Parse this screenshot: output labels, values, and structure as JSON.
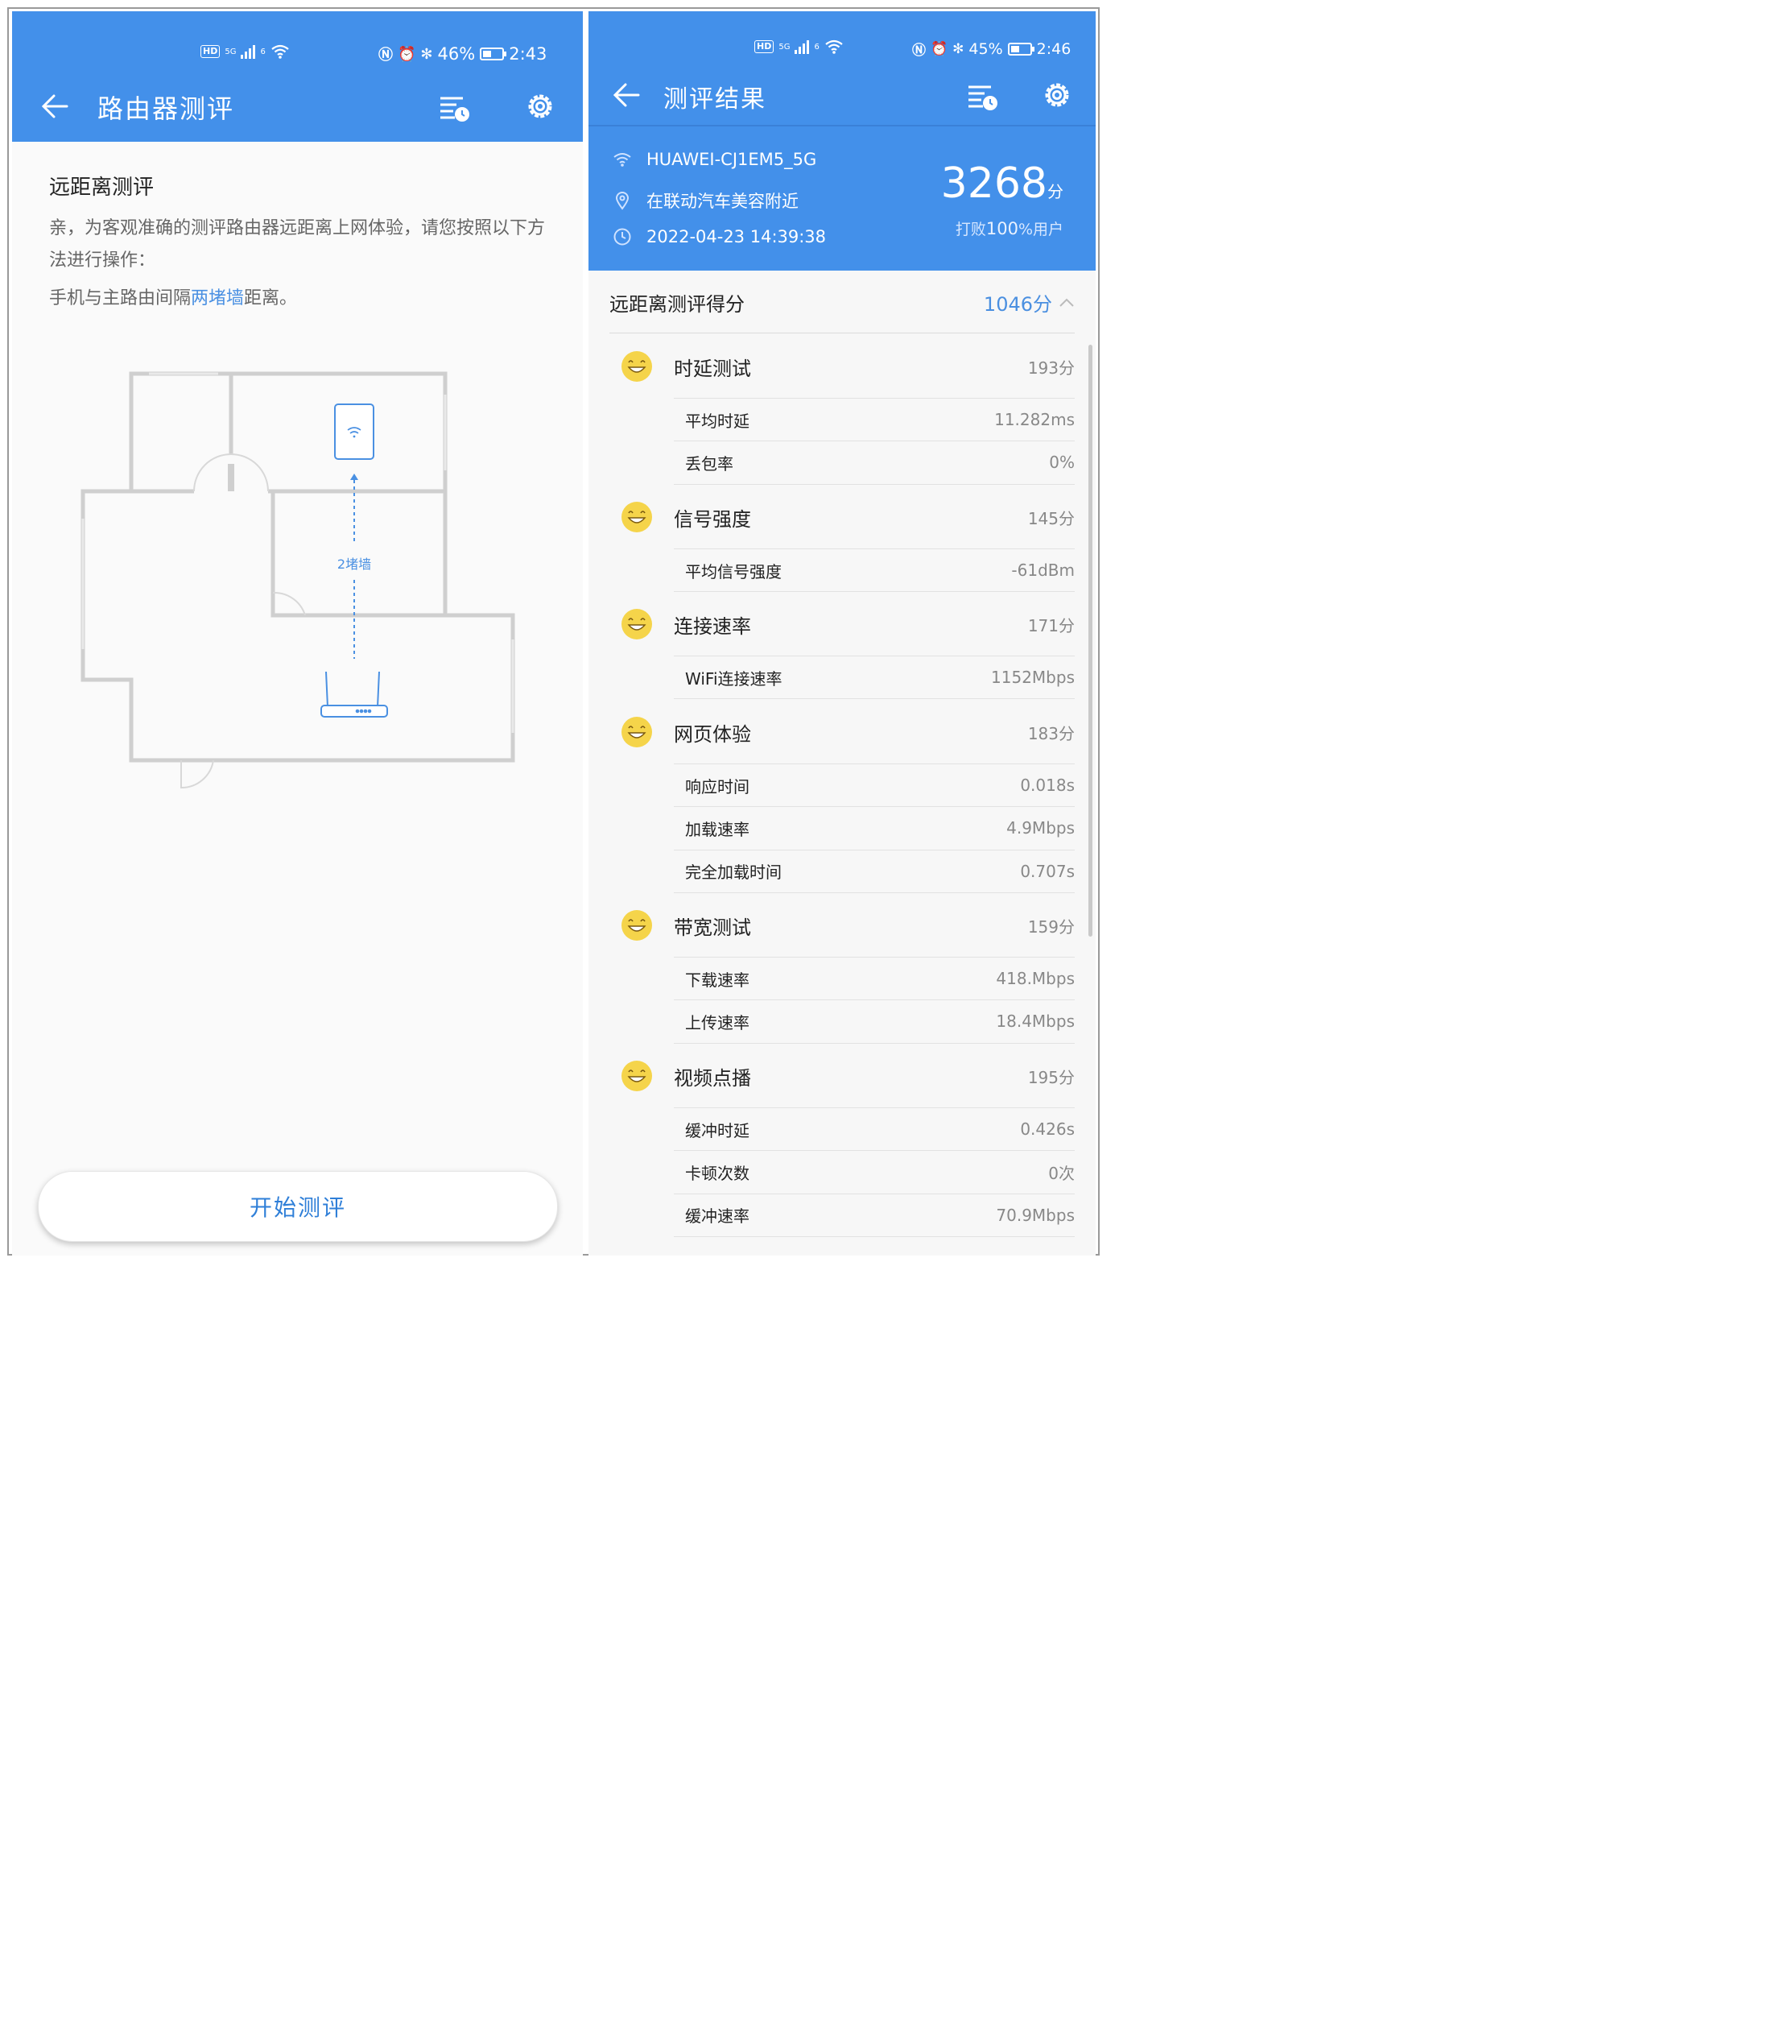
{
  "left": {
    "status": {
      "hd": "HD",
      "net": "5G",
      "wifi_sup": "6",
      "battery": "46%",
      "battery_level": 0.46,
      "time": "2:43"
    },
    "appbar": {
      "title": "路由器测评"
    },
    "section_title": "远距离测评",
    "instruction": "亲，为客观准确的测评路由器远距离上网体验，请您按照以下方法进行操作：",
    "distance_prefix": "手机与主路由间隔",
    "distance_highlight": "两堵墙",
    "distance_suffix": "距离。",
    "plan_wall_label": "2堵墙",
    "start_button": "开始测评"
  },
  "right": {
    "status": {
      "hd": "HD",
      "net": "5G",
      "wifi_sup": "6",
      "battery": "45%",
      "battery_level": 0.45,
      "time": "2:46"
    },
    "appbar": {
      "title": "测评结果"
    },
    "info": {
      "ssid": "HUAWEI-CJ1EM5_5G",
      "location": "在联动汽车美容附近",
      "datetime": "2022-04-23 14:39:38"
    },
    "total_score": "3268",
    "score_unit": "分",
    "beat_prefix": "打败",
    "beat_percent": "100",
    "beat_suffix": "%用户",
    "section": {
      "label": "远距离测评得分",
      "score": "1046分"
    },
    "categories": [
      {
        "name": "时延测试",
        "score": "193分"
      },
      {
        "name": "信号强度",
        "score": "145分"
      },
      {
        "name": "连接速率",
        "score": "171分"
      },
      {
        "name": "网页体验",
        "score": "183分"
      },
      {
        "name": "带宽测试",
        "score": "159分"
      },
      {
        "name": "视频点播",
        "score": "195分"
      }
    ],
    "subs": [
      {
        "name": "平均时延",
        "value": "11.282ms"
      },
      {
        "name": "丢包率",
        "value": "0%"
      },
      {
        "name": "平均信号强度",
        "value": "-61dBm"
      },
      {
        "name": "WiFi连接速率",
        "value": "1152Mbps"
      },
      {
        "name": "响应时间",
        "value": "0.018s"
      },
      {
        "name": "加载速率",
        "value": "4.9Mbps"
      },
      {
        "name": "完全加载时间",
        "value": "0.707s"
      },
      {
        "name": "下载速率",
        "value": "418.Mbps"
      },
      {
        "name": "上传速率",
        "value": "18.4Mbps"
      },
      {
        "name": "缓冲时延",
        "value": "0.426s"
      },
      {
        "name": "卡顿次数",
        "value": "0次"
      },
      {
        "name": "缓冲速率",
        "value": "70.9Mbps"
      }
    ]
  },
  "colors": {
    "primary": "#4390ea",
    "accent_text": "#4a8fe0",
    "face": "#f5d44a"
  }
}
